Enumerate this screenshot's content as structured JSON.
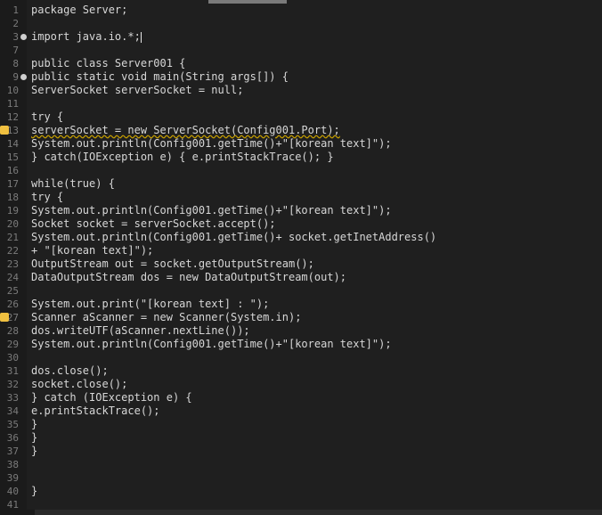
{
  "code": {
    "lines": [
      {
        "n": "1",
        "text": "package Server;"
      },
      {
        "n": "2",
        "text": ""
      },
      {
        "n": "3",
        "text": "import java.io.*;"
      },
      {
        "n": "7",
        "text": ""
      },
      {
        "n": "8",
        "text": "public class Server001 {"
      },
      {
        "n": "9",
        "text": "public static void main(String args[]) {"
      },
      {
        "n": "10",
        "text": "ServerSocket serverSocket = null;"
      },
      {
        "n": "11",
        "text": ""
      },
      {
        "n": "12",
        "text": "try {"
      },
      {
        "n": "13",
        "text": "serverSocket = new ServerSocket(Config001.Port);"
      },
      {
        "n": "14",
        "text": "System.out.println(Config001.getTime()+\"[korean text]\");"
      },
      {
        "n": "15",
        "text": "} catch(IOException e) { e.printStackTrace(); }"
      },
      {
        "n": "16",
        "text": ""
      },
      {
        "n": "17",
        "text": "while(true) {"
      },
      {
        "n": "18",
        "text": "try {"
      },
      {
        "n": "19",
        "text": "System.out.println(Config001.getTime()+\"[korean text]\");"
      },
      {
        "n": "20",
        "text": "Socket socket = serverSocket.accept();"
      },
      {
        "n": "21",
        "text": "System.out.println(Config001.getTime()+ socket.getInetAddress()"
      },
      {
        "n": "22",
        "text": "+ \"[korean text]\");"
      },
      {
        "n": "23",
        "text": "OutputStream out = socket.getOutputStream();"
      },
      {
        "n": "24",
        "text": "DataOutputStream dos = new DataOutputStream(out);"
      },
      {
        "n": "25",
        "text": ""
      },
      {
        "n": "26",
        "text": "System.out.print(\"[korean text] : \");"
      },
      {
        "n": "27",
        "text": "Scanner aScanner = new Scanner(System.in);"
      },
      {
        "n": "28",
        "text": "dos.writeUTF(aScanner.nextLine());"
      },
      {
        "n": "29",
        "text": "System.out.println(Config001.getTime()+\"[korean text]\");"
      },
      {
        "n": "30",
        "text": ""
      },
      {
        "n": "31",
        "text": "dos.close();"
      },
      {
        "n": "32",
        "text": "socket.close();"
      },
      {
        "n": "33",
        "text": "} catch (IOException e) {"
      },
      {
        "n": "34",
        "text": "e.printStackTrace();"
      },
      {
        "n": "35",
        "text": "}"
      },
      {
        "n": "36",
        "text": "}"
      },
      {
        "n": "37",
        "text": "}"
      },
      {
        "n": "38",
        "text": ""
      },
      {
        "n": "39",
        "text": ""
      },
      {
        "n": "40",
        "text": "}"
      },
      {
        "n": "41",
        "text": ""
      }
    ]
  }
}
